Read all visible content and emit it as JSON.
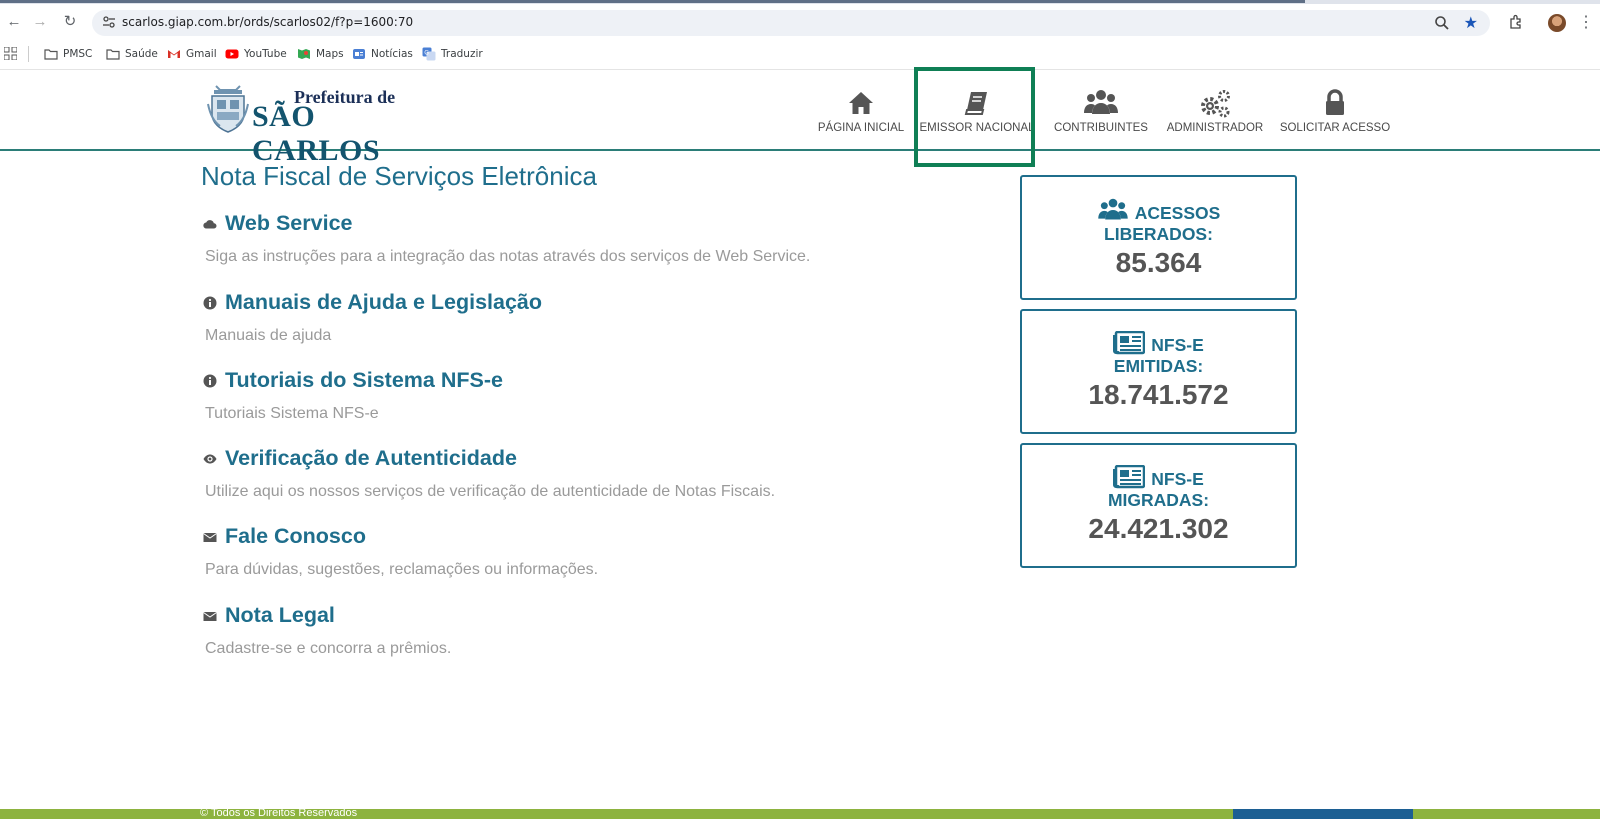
{
  "browser": {
    "url": "scarlos.giap.com.br/ords/scarlos02/f?p=1600:70",
    "bookmarks": [
      {
        "label": "PMSC",
        "icon": "folder-icon"
      },
      {
        "label": "Saúde",
        "icon": "folder-icon"
      },
      {
        "label": "Gmail",
        "icon": "gmail-icon"
      },
      {
        "label": "YouTube",
        "icon": "youtube-icon"
      },
      {
        "label": "Maps",
        "icon": "maps-icon"
      },
      {
        "label": "Notícias",
        "icon": "news-icon"
      },
      {
        "label": "Traduzir",
        "icon": "translate-icon"
      }
    ]
  },
  "header": {
    "logo_line1": "Prefeitura de",
    "logo_line2": "SÃO CARLOS",
    "nav": [
      {
        "label": "PÁGINA INICIAL",
        "icon": "home-icon"
      },
      {
        "label": "EMISSOR NACIONAL",
        "icon": "book-icon"
      },
      {
        "label": "CONTRIBUINTES",
        "icon": "users-icon"
      },
      {
        "label": "ADMINISTRADOR",
        "icon": "gears-icon"
      },
      {
        "label": "SOLICITAR ACESSO",
        "icon": "lock-icon"
      }
    ]
  },
  "main": {
    "title": "Nota Fiscal de Serviços Eletrônica",
    "sections": [
      {
        "title": "Web Service",
        "desc": "Siga as instruções para a integração das notas através dos serviços de Web Service.",
        "icon": "cloud-icon"
      },
      {
        "title": "Manuais de Ajuda e Legislação",
        "desc": "Manuais de ajuda",
        "icon": "info-icon"
      },
      {
        "title": "Tutoriais do Sistema NFS-e",
        "desc": "Tutoriais Sistema NFS-e",
        "icon": "info-icon"
      },
      {
        "title": "Verificação de Autenticidade",
        "desc": "Utilize aqui os nossos serviços de verificação de autenticidade de Notas Fiscais.",
        "icon": "eye-icon"
      },
      {
        "title": "Fale Conosco",
        "desc": "Para dúvidas, sugestões, reclamações ou informações.",
        "icon": "envelope-icon"
      },
      {
        "title": "Nota Legal",
        "desc": "Cadastre-se e concorra a prêmios.",
        "icon": "envelope-icon"
      }
    ]
  },
  "stats": [
    {
      "label_line1": "ACESSOS",
      "label_line2": "LIBERADOS:",
      "value": "85.364",
      "icon": "users-icon"
    },
    {
      "label_line1": "NFS-E",
      "label_line2": "EMITIDAS:",
      "value": "18.741.572",
      "icon": "newspaper-icon"
    },
    {
      "label_line1": "NFS-E",
      "label_line2": "MIGRADAS:",
      "value": "24.421.302",
      "icon": "newspaper-icon"
    }
  ],
  "footer": {
    "copyright": "© Todos os Direitos Reservados"
  },
  "colors": {
    "primary": "#1f6e8c",
    "highlight": "#0f7f55",
    "footer": "#8db33f"
  }
}
